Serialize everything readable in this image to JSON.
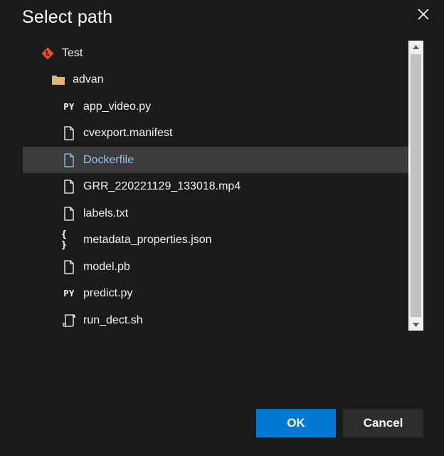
{
  "dialog": {
    "title": "Select path"
  },
  "tree": {
    "items": [
      {
        "label": "Test",
        "icon": "git-repo-icon",
        "selected": false
      },
      {
        "label": "advan",
        "icon": "folder-icon",
        "selected": false
      },
      {
        "label": "app_video.py",
        "icon": "python-file-icon",
        "icon_text": "PY",
        "selected": false
      },
      {
        "label": "cvexport.manifest",
        "icon": "file-icon",
        "selected": false
      },
      {
        "label": "Dockerfile",
        "icon": "file-icon",
        "selected": true
      },
      {
        "label": "GRR_220221129_133018.mp4",
        "icon": "file-icon",
        "selected": false
      },
      {
        "label": "labels.txt",
        "icon": "file-icon",
        "selected": false
      },
      {
        "label": "metadata_properties.json",
        "icon": "json-file-icon",
        "icon_text": "{ }",
        "selected": false
      },
      {
        "label": "model.pb",
        "icon": "file-icon",
        "selected": false
      },
      {
        "label": "predict.py",
        "icon": "python-file-icon",
        "icon_text": "PY",
        "selected": false
      },
      {
        "label": "run_dect.sh",
        "icon": "script-file-icon",
        "selected": false
      }
    ]
  },
  "buttons": {
    "ok_label": "OK",
    "cancel_label": "Cancel"
  },
  "colors": {
    "background": "#1b1b1b",
    "selected_row": "#3b3b3b",
    "selected_text": "#9cc7ee",
    "primary_button": "#0078d4",
    "secondary_button": "#2d2d2d",
    "git_icon": "#e8503a",
    "folder_icon": "#dcb67a"
  }
}
